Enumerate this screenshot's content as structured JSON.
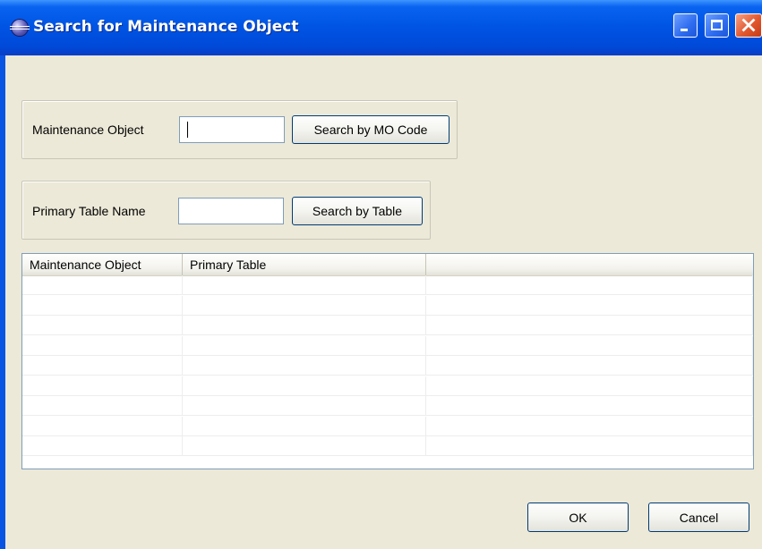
{
  "window": {
    "title": "Search for Maintenance Object"
  },
  "search_mo": {
    "label": "Maintenance Object",
    "value": "",
    "button_label": "Search by MO Code"
  },
  "search_table": {
    "label": "Primary Table Name",
    "value": "",
    "button_label": "Search by Table"
  },
  "results": {
    "columns": [
      "Maintenance Object",
      "Primary Table",
      ""
    ],
    "rows": [
      [
        "",
        "",
        ""
      ],
      [
        "",
        "",
        ""
      ],
      [
        "",
        "",
        ""
      ],
      [
        "",
        "",
        ""
      ],
      [
        "",
        "",
        ""
      ],
      [
        "",
        "",
        ""
      ],
      [
        "",
        "",
        ""
      ],
      [
        "",
        "",
        ""
      ],
      [
        "",
        "",
        ""
      ]
    ]
  },
  "footer": {
    "ok_label": "OK",
    "cancel_label": "Cancel"
  },
  "colors": {
    "titlebar": "#0055e5",
    "dialog_background": "#ece9d8",
    "close_button": "#e1582f"
  }
}
